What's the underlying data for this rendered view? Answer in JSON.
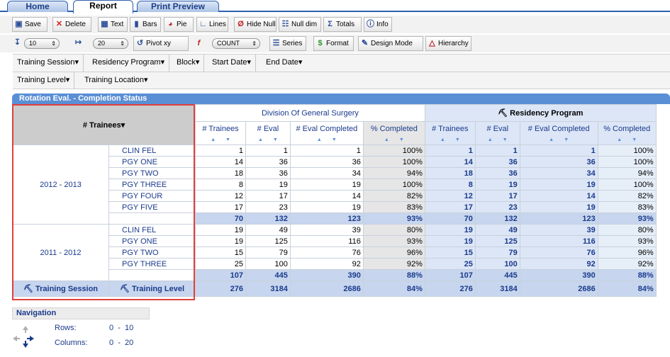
{
  "tabs": [
    {
      "label": "Home"
    },
    {
      "label": "Report"
    },
    {
      "label": "Print Preview"
    }
  ],
  "toolbar1": {
    "save": "Save",
    "delete": "Delete",
    "text": "Text",
    "bars": "Bars",
    "pie": "Pie",
    "lines": "Lines",
    "hide_null": "Hide Null",
    "null_dim": "Null dim",
    "totals": "Totals",
    "info": "Info"
  },
  "toolbar2": {
    "rows_limit": "10",
    "cols_limit": "20",
    "pivot": "Pivot xy",
    "function": "COUNT",
    "series": "Series",
    "format": "Format",
    "design_mode": "Design Mode",
    "hierarchy": "Hierarchy"
  },
  "dimensions_row1": [
    "Training Session",
    "Residency Program",
    "Block",
    "Start Date",
    "End Date"
  ],
  "dimensions_row2": [
    "Training Level",
    "Training Location"
  ],
  "report_title": "Rotation Eval. - Completion Status",
  "table": {
    "corner_label": "# Trainees",
    "group1": "Division Of General Surgery",
    "group2": "Residency Program",
    "measures": [
      "# Trainees",
      "# Eval",
      "# Eval Completed",
      "% Completed"
    ],
    "row_dim1_btn": "Training Session",
    "row_dim2_btn": "Training Level",
    "years": [
      {
        "label": "2012 - 2013",
        "rows": [
          {
            "level": "CLIN FEL",
            "v": [
              "1",
              "1",
              "1",
              "100%",
              "1",
              "1",
              "1",
              "100%"
            ]
          },
          {
            "level": "PGY ONE",
            "v": [
              "14",
              "36",
              "36",
              "100%",
              "14",
              "36",
              "36",
              "100%"
            ]
          },
          {
            "level": "PGY TWO",
            "v": [
              "18",
              "36",
              "34",
              "94%",
              "18",
              "36",
              "34",
              "94%"
            ]
          },
          {
            "level": "PGY THREE",
            "v": [
              "8",
              "19",
              "19",
              "100%",
              "8",
              "19",
              "19",
              "100%"
            ]
          },
          {
            "level": "PGY FOUR",
            "v": [
              "12",
              "17",
              "14",
              "82%",
              "12",
              "17",
              "14",
              "82%"
            ]
          },
          {
            "level": "PGY FIVE",
            "v": [
              "17",
              "23",
              "19",
              "83%",
              "17",
              "23",
              "19",
              "83%"
            ]
          }
        ],
        "subtotal": [
          "70",
          "132",
          "123",
          "93%",
          "70",
          "132",
          "123",
          "93%"
        ]
      },
      {
        "label": "2011 - 2012",
        "rows": [
          {
            "level": "CLIN FEL",
            "v": [
              "19",
              "49",
              "39",
              "80%",
              "19",
              "49",
              "39",
              "80%"
            ]
          },
          {
            "level": "PGY ONE",
            "v": [
              "19",
              "125",
              "116",
              "93%",
              "19",
              "125",
              "116",
              "93%"
            ]
          },
          {
            "level": "PGY TWO",
            "v": [
              "15",
              "79",
              "76",
              "96%",
              "15",
              "79",
              "76",
              "96%"
            ]
          },
          {
            "level": "PGY THREE",
            "v": [
              "25",
              "100",
              "92",
              "92%",
              "25",
              "100",
              "92",
              "92%"
            ]
          }
        ],
        "subtotal": [
          "107",
          "445",
          "390",
          "88%",
          "107",
          "445",
          "390",
          "88%"
        ]
      }
    ],
    "grand_total": [
      "276",
      "3184",
      "2686",
      "84%",
      "276",
      "3184",
      "2686",
      "84%"
    ]
  },
  "navigation": {
    "title": "Navigation",
    "rows_label": "Rows:",
    "rows_value": "0  -  10",
    "columns_label": "Columns:",
    "columns_value": "0  -  20"
  }
}
